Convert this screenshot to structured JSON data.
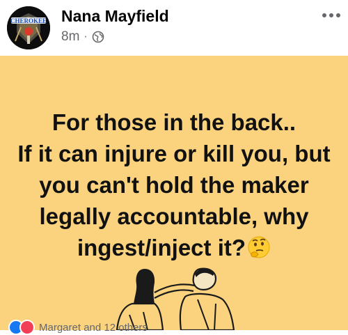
{
  "post": {
    "author": "Nana Mayfield",
    "timestamp": "8m",
    "separator": "·",
    "privacy_icon": "globe-icon",
    "more_icon": "more-options-icon",
    "avatar_text": "CHEROKEE",
    "lines": [
      "For those in the back..",
      "If it can injure or kill you, but",
      "you can't hold the maker",
      "legally accountable, why",
      "ingest/inject it?"
    ],
    "emoji": "thinking-face-icon",
    "background_color": "#fbd37f"
  },
  "reactions": {
    "icons": [
      "like-icon",
      "love-icon"
    ],
    "text": "Margaret and 12 others"
  }
}
